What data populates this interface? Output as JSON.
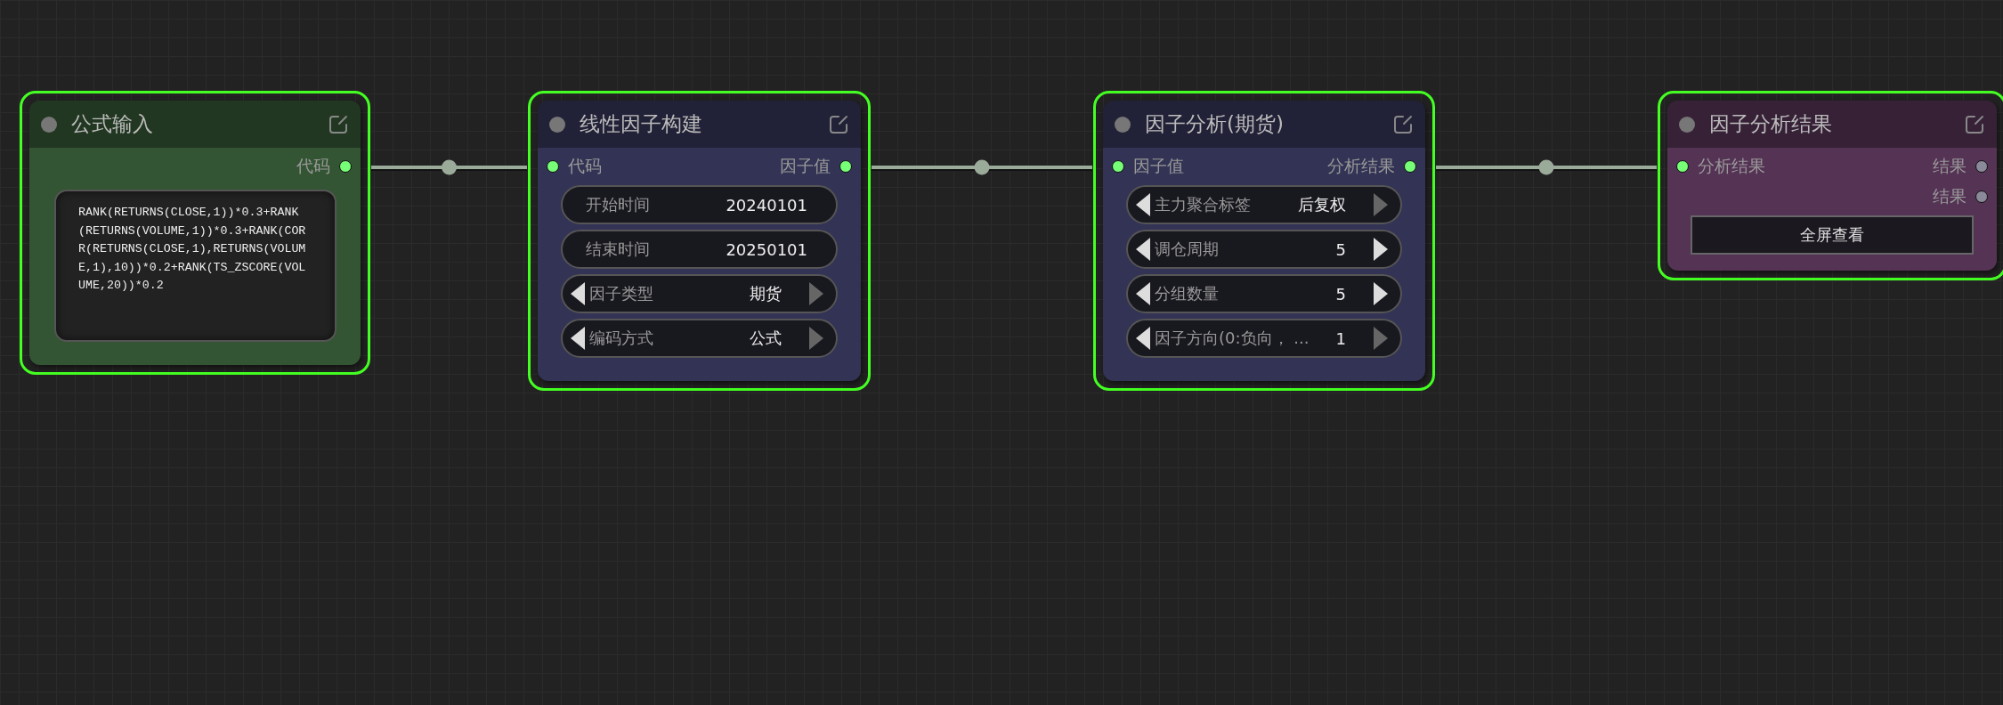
{
  "nodes": [
    {
      "title": "公式输入",
      "color": "#335533",
      "selected": true,
      "outputs": [
        {
          "label": "代码",
          "connected": true
        }
      ],
      "widgets": [
        {
          "kind": "code",
          "value": "RANK(RETURNS(CLOSE,1))*0.3+RANK(RETURNS(VOLUME,1))*0.3+RANK(CORR(RETURNS(CLOSE,1),RETURNS(VOLUME,1),10))*0.2+RANK(TS_ZSCORE(VOLUME,20))*0.2"
        }
      ]
    },
    {
      "title": "线性因子构建",
      "color": "#333355",
      "selected": true,
      "inputs": [
        {
          "label": "代码",
          "connected": true
        }
      ],
      "outputs": [
        {
          "label": "因子值",
          "connected": true
        }
      ],
      "widgets": [
        {
          "kind": "field",
          "label": "开始时间",
          "value": "20240101"
        },
        {
          "kind": "field",
          "label": "结束时间",
          "value": "20250101"
        },
        {
          "kind": "stepper",
          "label": "因子类型",
          "value": "期货",
          "prev_enabled": true,
          "next_enabled": false
        },
        {
          "kind": "stepper",
          "label": "编码方式",
          "value": "公式",
          "prev_enabled": true,
          "next_enabled": false
        }
      ]
    },
    {
      "title": "因子分析(期货)",
      "color": "#333355",
      "selected": true,
      "inputs": [
        {
          "label": "因子值",
          "connected": true
        }
      ],
      "outputs": [
        {
          "label": "分析结果",
          "connected": true
        }
      ],
      "widgets": [
        {
          "kind": "stepper",
          "label": "主力聚合标签",
          "value": "后复权",
          "prev_enabled": true,
          "next_enabled": false
        },
        {
          "kind": "stepper",
          "label": "调仓周期",
          "value": "5",
          "prev_enabled": true,
          "next_enabled": true
        },
        {
          "kind": "stepper",
          "label": "分组数量",
          "value": "5",
          "prev_enabled": true,
          "next_enabled": true
        },
        {
          "kind": "stepper",
          "label": "因子方向(0:负向， ...",
          "value": "1",
          "prev_enabled": true,
          "next_enabled": false
        }
      ]
    },
    {
      "title": "因子分析结果",
      "color": "#553355",
      "selected": true,
      "inputs": [
        {
          "label": "分析结果",
          "connected": true
        }
      ],
      "outputs": [
        {
          "label": "结果",
          "connected": false
        },
        {
          "label": "结果",
          "connected": false
        }
      ],
      "widgets": [
        {
          "kind": "button",
          "label": "全屏查看"
        }
      ]
    }
  ]
}
